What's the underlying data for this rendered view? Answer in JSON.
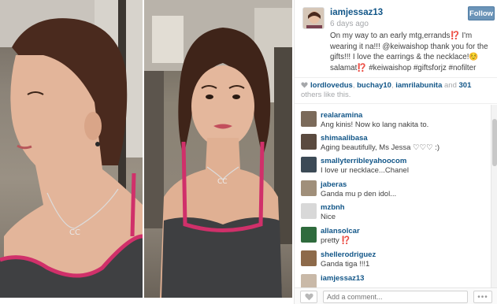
{
  "post": {
    "username": "iamjessaz13",
    "timestamp": "6 days ago",
    "follow_label": "Follow",
    "caption": "On my way to an early mtg,errands⁉️ I'm wearing it na!!! @keiwaishop thank you for the gifts!!! I love the earrings & the necklace!☺️ salamat⁉️ #keiwaishop #giftsforjz #nofilter"
  },
  "likes": {
    "likers": [
      "lordlovedus",
      "buchay10",
      "iamrilabunita"
    ],
    "sep1": ", ",
    "sep2": ", ",
    "and_text": " and ",
    "others_count": "301",
    "others_text": " others like this."
  },
  "comments": [
    {
      "user": "realaramina",
      "text": "Ang kinis! Now ko lang nakita to.",
      "avatar_color": "#7b6a5a"
    },
    {
      "user": "shimaalibasa",
      "text": "Aging beautifully, Ms Jessa ♡♡♡ :)",
      "avatar_color": "#5a4a3f"
    },
    {
      "user": "smallyterribleyahoocom",
      "text": "I love ur necklace...Chanel",
      "avatar_color": "#3c4a56"
    },
    {
      "user": "jaberas",
      "text": "Ganda mu p den idol...",
      "avatar_color": "#a08f7a"
    },
    {
      "user": "mzbnh",
      "text": "Nice",
      "avatar_color": "#d8d8d8"
    },
    {
      "user": "allansolcar",
      "text": "pretty ⁉️",
      "avatar_color": "#2f6b3d"
    },
    {
      "user": "shellerodriguez",
      "text": "Ganda tiga !!!1",
      "avatar_color": "#8d6a4a"
    },
    {
      "user": "iamjessaz13",
      "text": "",
      "avatar_color": "#c9b9a8"
    }
  ],
  "input": {
    "placeholder": "Add a comment...",
    "more_label": "•••"
  },
  "colors": {
    "link": "#125688",
    "follow_button": "#6b94b8",
    "muted": "#a5a7aa"
  },
  "icons": {
    "like": "heart-icon",
    "more": "ellipsis-icon"
  }
}
